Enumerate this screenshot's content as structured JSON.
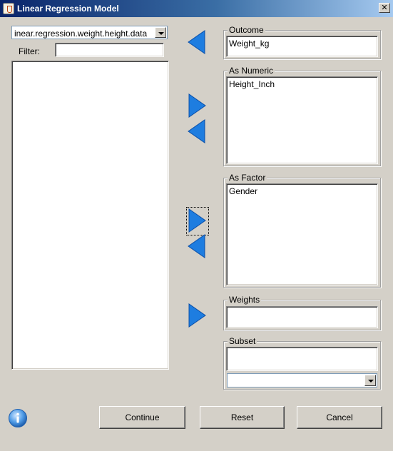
{
  "window": {
    "title": "Linear Regression Model",
    "close_glyph": "✕"
  },
  "source": {
    "dataset_value": "inear.regression.weight.height.data",
    "filter_label": "Filter:",
    "filter_value": "",
    "variables": []
  },
  "fields": {
    "outcome": {
      "label": "Outcome",
      "value": "Weight_kg"
    },
    "as_numeric": {
      "label": "As Numeric",
      "items": [
        "Height_Inch"
      ]
    },
    "as_factor": {
      "label": "As Factor",
      "items": [
        "Gender"
      ]
    },
    "weights": {
      "label": "Weights",
      "value": ""
    },
    "subset": {
      "label": "Subset",
      "value": "",
      "dropdown_value": ""
    }
  },
  "buttons": {
    "continue": "Continue",
    "reset": "Reset",
    "cancel": "Cancel"
  },
  "icons": {
    "arrow_left": "arrow-left-icon",
    "arrow_right": "arrow-right-icon",
    "info": "info-icon"
  },
  "colors": {
    "arrow_blue": "#1e7de0",
    "title_start": "#0a246a",
    "title_end": "#a6caf0"
  }
}
